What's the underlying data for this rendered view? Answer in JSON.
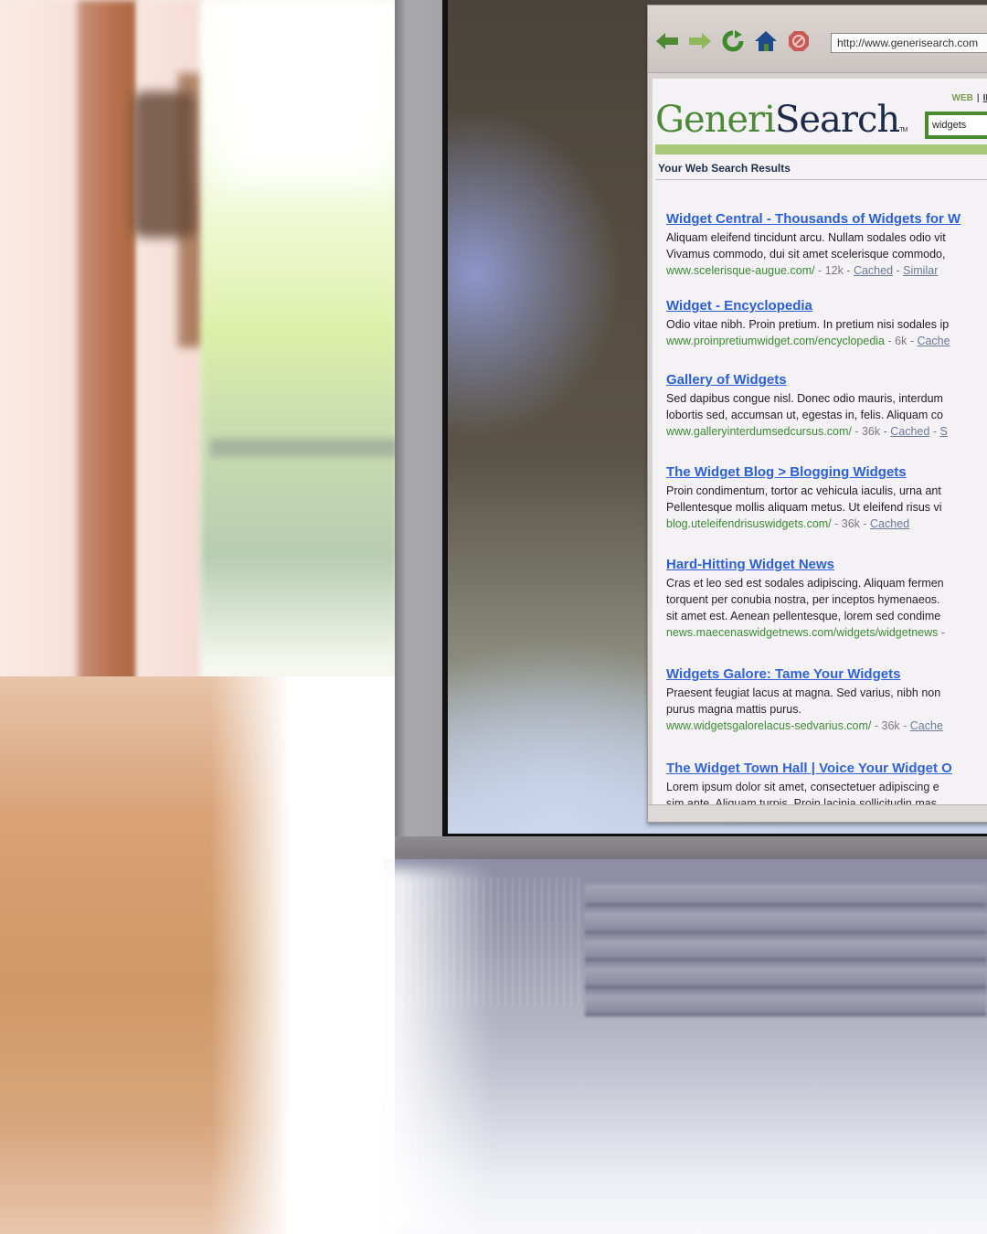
{
  "browser": {
    "nav_buttons": [
      {
        "name": "back",
        "icon": "arrow-left-icon",
        "color": "#4f8a32"
      },
      {
        "name": "forward",
        "icon": "arrow-right-icon",
        "color": "#8fb85a"
      },
      {
        "name": "reload",
        "icon": "refresh-icon",
        "color": "#3f8a2a"
      },
      {
        "name": "home",
        "icon": "home-icon",
        "color": "#1d4a8a"
      },
      {
        "name": "stop",
        "icon": "stop-icon",
        "color": "#c85a54"
      }
    ],
    "address": "http://www.generisearch.com"
  },
  "page": {
    "nav": {
      "web": "WEB",
      "separator": "|",
      "images": "IMA"
    },
    "logo": {
      "part1": "Generi",
      "part2": "Search",
      "tm": "TM"
    },
    "search_value": "widgets",
    "results_heading": "Your Web Search Results",
    "colors": {
      "brand_green": "#4c8a3a",
      "brand_navy": "#1d2a48",
      "link_blue": "#2b5fd6",
      "url_green": "#3b8a34",
      "bar_green": "#a9c97a"
    },
    "results": [
      {
        "title": "Widget Central - Thousands of Widgets for W",
        "desc": [
          "Aliquam eleifend tincidunt arcu. Nullam sodales odio vit",
          "Vivamus commodo, dui sit amet scelerisque commodo,"
        ],
        "url": "www.scelerisque-augue.com/",
        "size": " - 12k - ",
        "links": [
          "Cached",
          "Similar"
        ]
      },
      {
        "title": "Widget - Encyclopedia",
        "desc": [
          "Odio vitae nibh. Proin pretium. In pretium nisi sodales ip"
        ],
        "url": "www.proinpretiumwidget.com/encyclopedia",
        "size": " - 6k - ",
        "links": [
          "Cache"
        ]
      },
      {
        "title": "Gallery of Widgets",
        "desc": [
          "Sed dapibus congue nisl. Donec odio mauris, interdum",
          "lobortis sed, accumsan ut, egestas in, felis. Aliquam co"
        ],
        "url": "www.galleryinterdumsedcursus.com/",
        "size": " - 36k - ",
        "links": [
          "Cached",
          "S"
        ]
      },
      {
        "title": "The Widget Blog > Blogging Widgets",
        "desc": [
          "Proin condimentum, tortor ac vehicula iaculis, urna ant",
          "Pellentesque mollis aliquam metus. Ut eleifend risus vi"
        ],
        "url": "blog.uteleifendrisuswidgets.com/",
        "size": " - 36k - ",
        "links": [
          "Cached"
        ]
      },
      {
        "title": "Hard-Hitting Widget News",
        "desc": [
          "Cras et leo sed est sodales adipiscing. Aliquam fermen",
          "torquent per conubia nostra, per inceptos hymenaeos.",
          "sit amet est. Aenean pellentesque, lorem sed condime"
        ],
        "url": "news.maecenaswidgetnews.com/widgets/widgetnews",
        "size": " - ",
        "links": []
      },
      {
        "title": "Widgets Galore: Tame Your Widgets",
        "desc": [
          "Praesent feugiat lacus at magna. Sed varius, nibh non",
          "purus magna mattis purus."
        ],
        "url": "www.widgetsgalorelacus-sedvarius.com/",
        "size": " - 36k - ",
        "links": [
          "Cache"
        ]
      },
      {
        "title": "The Widget Town Hall | Voice Your Widget O",
        "desc": [
          "Lorem ipsum dolor sit amet, consectetuer adipiscing e",
          "sim ante. Aliquam turpis. Proin lacinia sollicitudin mas"
        ],
        "url": "",
        "size": "",
        "links": []
      }
    ]
  }
}
